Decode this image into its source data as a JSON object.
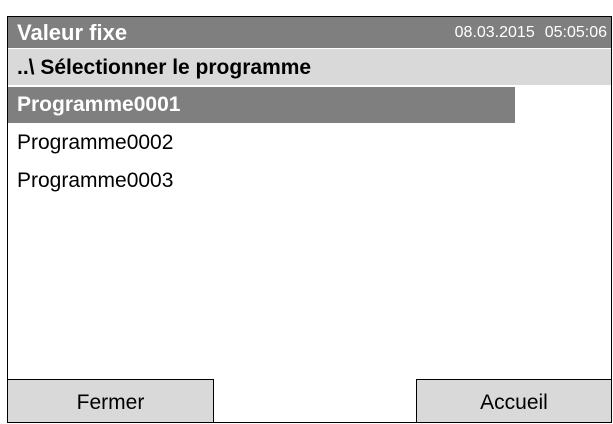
{
  "header": {
    "title": "Valeur fixe",
    "date": "08.03.2015",
    "time": "05:05:06"
  },
  "path": {
    "label": "..\\ Sélectionner le programme"
  },
  "programs": {
    "items": [
      {
        "label": "Programme0001",
        "selected": true
      },
      {
        "label": "Programme0002",
        "selected": false
      },
      {
        "label": "Programme0003",
        "selected": false
      }
    ]
  },
  "buttons": {
    "close_label": "Fermer",
    "home_label": "Accueil"
  },
  "colors": {
    "titlebar_bg": "#7f7f7f",
    "pathbar_bg": "#d9d9d9",
    "selected_bg": "#7f7f7f",
    "button_bg": "#d9d9d9"
  }
}
